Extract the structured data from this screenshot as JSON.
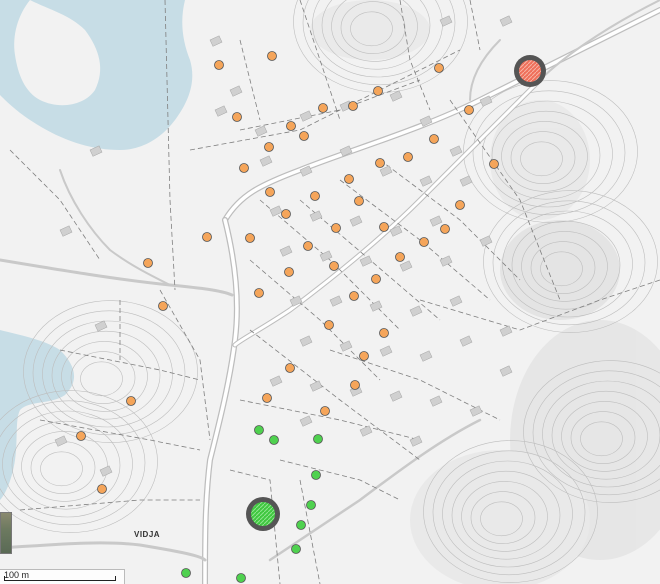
{
  "map": {
    "place_label": "VIDJA",
    "scale_label": "100 m",
    "colors": {
      "land": "#f2f2f2",
      "water": "#c7dde6",
      "road": "#c9c9c9",
      "contour": "#b8b8b8",
      "plot_border": "#8a8a8a",
      "marker_orange": "#f5a55a",
      "marker_green": "#4fd14f",
      "selected_orange": "#ef6f5a",
      "selected_green": "#3fc73f",
      "selected_ring": "#555555"
    }
  }
}
